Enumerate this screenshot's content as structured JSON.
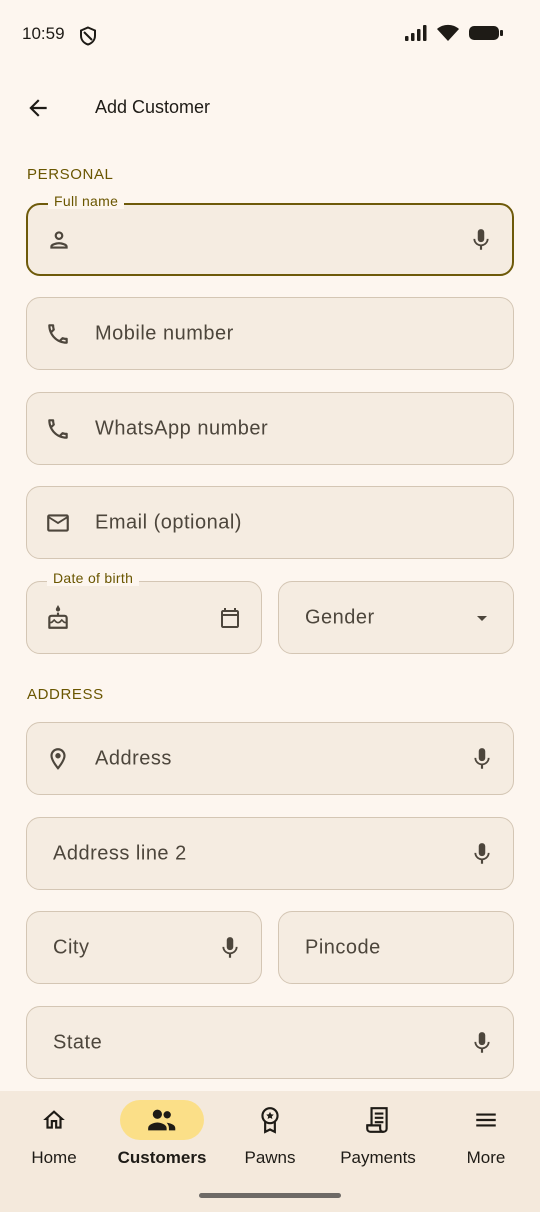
{
  "status_bar": {
    "time": "10:59",
    "icons": [
      "shield-icon",
      "signal-icon",
      "wifi-icon",
      "battery-icon"
    ]
  },
  "app_bar": {
    "title": "Add Customer",
    "back_icon": "arrow-back-icon"
  },
  "sections": {
    "personal": "PERSONAL",
    "address": "ADDRESS"
  },
  "fields": {
    "full_name": {
      "label": "Full name",
      "value": "",
      "lead_icon": "person-icon",
      "trail_icon": "mic-icon"
    },
    "mobile": {
      "placeholder": "Mobile number",
      "lead_icon": "phone-icon"
    },
    "whatsapp": {
      "placeholder": "WhatsApp number",
      "lead_icon": "phone-icon"
    },
    "email": {
      "placeholder": "Email (optional)",
      "lead_icon": "mail-icon"
    },
    "dob": {
      "label": "Date of birth",
      "value": "",
      "lead_icon": "cake-icon",
      "trail_icon": "calendar-icon"
    },
    "gender": {
      "placeholder": "Gender",
      "trail_icon": "dropdown-arrow-icon"
    },
    "address": {
      "placeholder": "Address",
      "lead_icon": "location-pin-icon",
      "trail_icon": "mic-icon"
    },
    "address2": {
      "placeholder": "Address line 2",
      "trail_icon": "mic-icon"
    },
    "city": {
      "placeholder": "City",
      "trail_icon": "mic-icon"
    },
    "pincode": {
      "placeholder": "Pincode"
    },
    "state": {
      "placeholder": "State",
      "trail_icon": "mic-icon"
    }
  },
  "bottom_nav": {
    "active": "Customers",
    "items": [
      {
        "label": "Home",
        "icon": "home-icon"
      },
      {
        "label": "Customers",
        "icon": "people-icon"
      },
      {
        "label": "Pawns",
        "icon": "badge-icon"
      },
      {
        "label": "Payments",
        "icon": "receipt-icon"
      },
      {
        "label": "More",
        "icon": "menu-icon"
      }
    ]
  },
  "colors": {
    "background": "#FDF6EF",
    "field_bg": "#F5ECE1",
    "accent": "#6E5A0A",
    "active_pill": "#FBDF88",
    "nav_bg": "#F4E9DC"
  }
}
